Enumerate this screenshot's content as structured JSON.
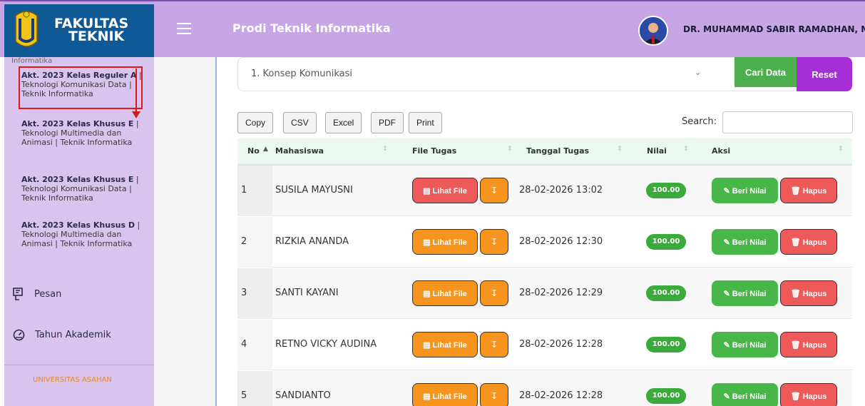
{
  "brand": {
    "line1": "FAKULTAS",
    "line2": "TEKNIK"
  },
  "header": {
    "title": "Prodi Teknik Informatika",
    "user_name": "DR. MUHAMMAD SABIR RAMADHAN, M.KOM"
  },
  "sidebar": {
    "cut_text": "Informatika",
    "classes": [
      {
        "bold": "Akt. 2023 Kelas Reguler A",
        "rest": " | Teknologi Komunikasi Data | Teknik Informatika",
        "highlighted": true
      },
      {
        "bold": "Akt. 2023 Kelas Khusus E",
        "rest": " | Teknologi Multimedia dan Animasi | Teknik Informatika"
      },
      {
        "bold": "Akt. 2023 Kelas Khusus E",
        "rest": " | Teknologi Komunikasi Data | Teknik Informatika"
      },
      {
        "bold": "Akt. 2023 Kelas Khusus D",
        "rest": " | Teknologi Multimedia dan Animasi | Teknik Informatika"
      }
    ],
    "menu": [
      {
        "label": "Pesan",
        "icon": "message-icon"
      },
      {
        "label": "Tahun Akademik",
        "icon": "dashboard-icon"
      }
    ],
    "footer": "UNIVERSITAS ASAHAN"
  },
  "filter": {
    "selected": "1. Konsep Komunikasi",
    "search_button": "Cari Data",
    "reset_button": "Reset"
  },
  "datatable": {
    "buttons": [
      "Copy",
      "CSV",
      "Excel",
      "PDF",
      "Print"
    ],
    "search_label": "Search:",
    "columns": [
      "No",
      "Mahasiswa",
      "File Tugas",
      "Tanggal Tugas",
      "Nilai",
      "Aksi"
    ],
    "view_file_label": "Lihat File",
    "grade_label": "Beri Nilai",
    "delete_label": "Hapus",
    "rows": [
      {
        "no": "1",
        "name": "SUSILA MAYUSNI",
        "date": "28-02-2026 13:02",
        "score": "100.00",
        "file_color": "#ee5a5a"
      },
      {
        "no": "2",
        "name": "RIZKIA ANANDA",
        "date": "28-02-2026 12:30",
        "score": "100.00",
        "file_color": "#f7941d"
      },
      {
        "no": "3",
        "name": "SANTI KAYANI",
        "date": "28-02-2026 12:29",
        "score": "100.00",
        "file_color": "#f7941d"
      },
      {
        "no": "4",
        "name": "RETNO VICKY AUDINA",
        "date": "28-02-2026 12:28",
        "score": "100.00",
        "file_color": "#f7941d"
      },
      {
        "no": "5",
        "name": "SANDIANTO",
        "date": "28-02-2026 12:28",
        "score": "100.00",
        "file_color": "#f7941d"
      }
    ]
  },
  "colors": {
    "header": "#c8a6e6",
    "brand": "#0f5a96",
    "sidebar": "#d9c4ee",
    "success": "#4cae4c",
    "purple": "#a42fd4",
    "danger": "#ee5a5a",
    "warning": "#f7941d"
  }
}
